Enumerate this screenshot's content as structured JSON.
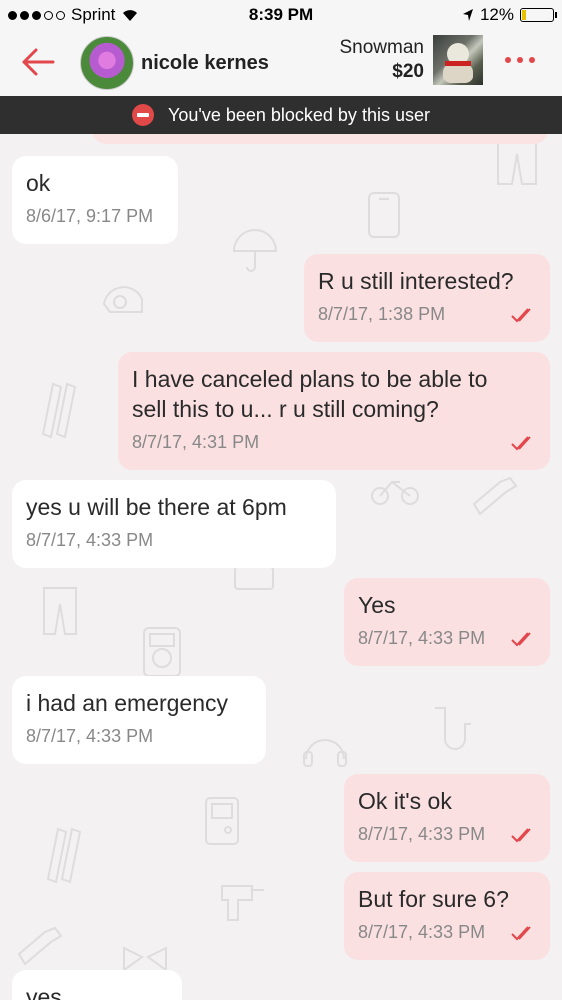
{
  "status_bar": {
    "carrier": "Sprint",
    "time": "8:39 PM",
    "battery": "12%"
  },
  "header": {
    "contact_name": "nicole kernes",
    "item_title": "Snowman",
    "item_price": "$20"
  },
  "banner": {
    "text": "You've been blocked by this user"
  },
  "messages": [
    {
      "direction": "in",
      "text": "ok",
      "time": "8/6/17, 9:17 PM"
    },
    {
      "direction": "out",
      "text": "R u still interested?",
      "time": "8/7/17, 1:38 PM"
    },
    {
      "direction": "out",
      "text": "I have canceled plans to be able to\nsell this to u... r u still coming?",
      "time": "8/7/17, 4:31 PM"
    },
    {
      "direction": "in",
      "text": "yes u will be there at 6pm",
      "time": "8/7/17, 4:33 PM"
    },
    {
      "direction": "out",
      "text": "Yes",
      "time": "8/7/17, 4:33 PM"
    },
    {
      "direction": "in",
      "text": "i had an emergency",
      "time": "8/7/17, 4:33 PM"
    },
    {
      "direction": "out",
      "text": "Ok it's ok",
      "time": "8/7/17, 4:33 PM"
    },
    {
      "direction": "out",
      "text": "But for sure 6?",
      "time": "8/7/17, 4:33 PM"
    },
    {
      "direction": "in",
      "text": "yes",
      "time": ""
    }
  ],
  "colors": {
    "accent": "#e2474b",
    "incoming_bubble": "#ffffff",
    "outgoing_bubble": "#fbe0e2",
    "banner_bg": "#2f2f2f",
    "read_ticks": "#e2474b"
  }
}
